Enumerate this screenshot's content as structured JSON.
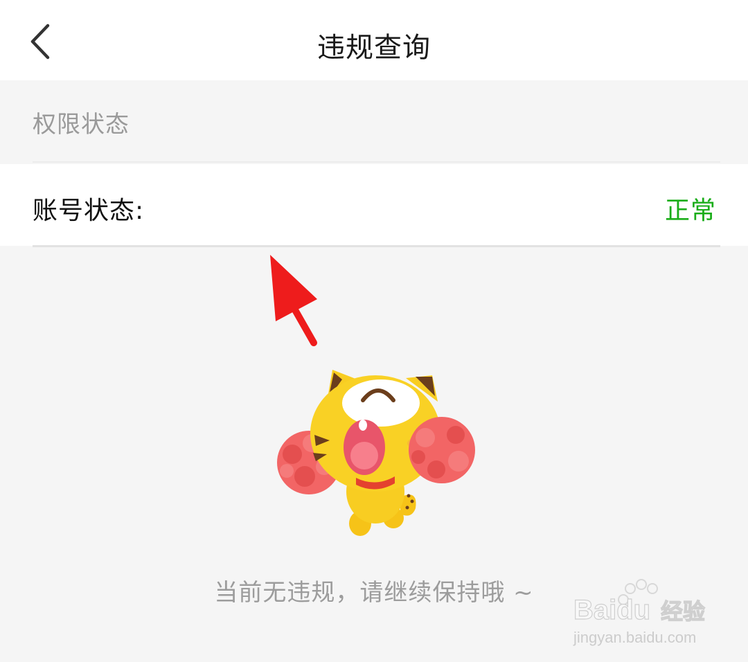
{
  "header": {
    "back_icon": "chevron-left-icon",
    "title": "违规查询"
  },
  "permission_section": {
    "label": "权限状态"
  },
  "account_status": {
    "label": "账号状态:",
    "value": "正常",
    "value_color": "#1aad19"
  },
  "empty_state": {
    "illustration": "cheering-cat-mascot",
    "message": "当前无违规，请继续保持哦 ~"
  },
  "annotation": {
    "icon": "red-arrow-icon",
    "color": "#ee1c1c"
  },
  "watermark": {
    "brand": "Baidu",
    "brand_suffix": "经验",
    "url": "jingyan.baidu.com"
  }
}
